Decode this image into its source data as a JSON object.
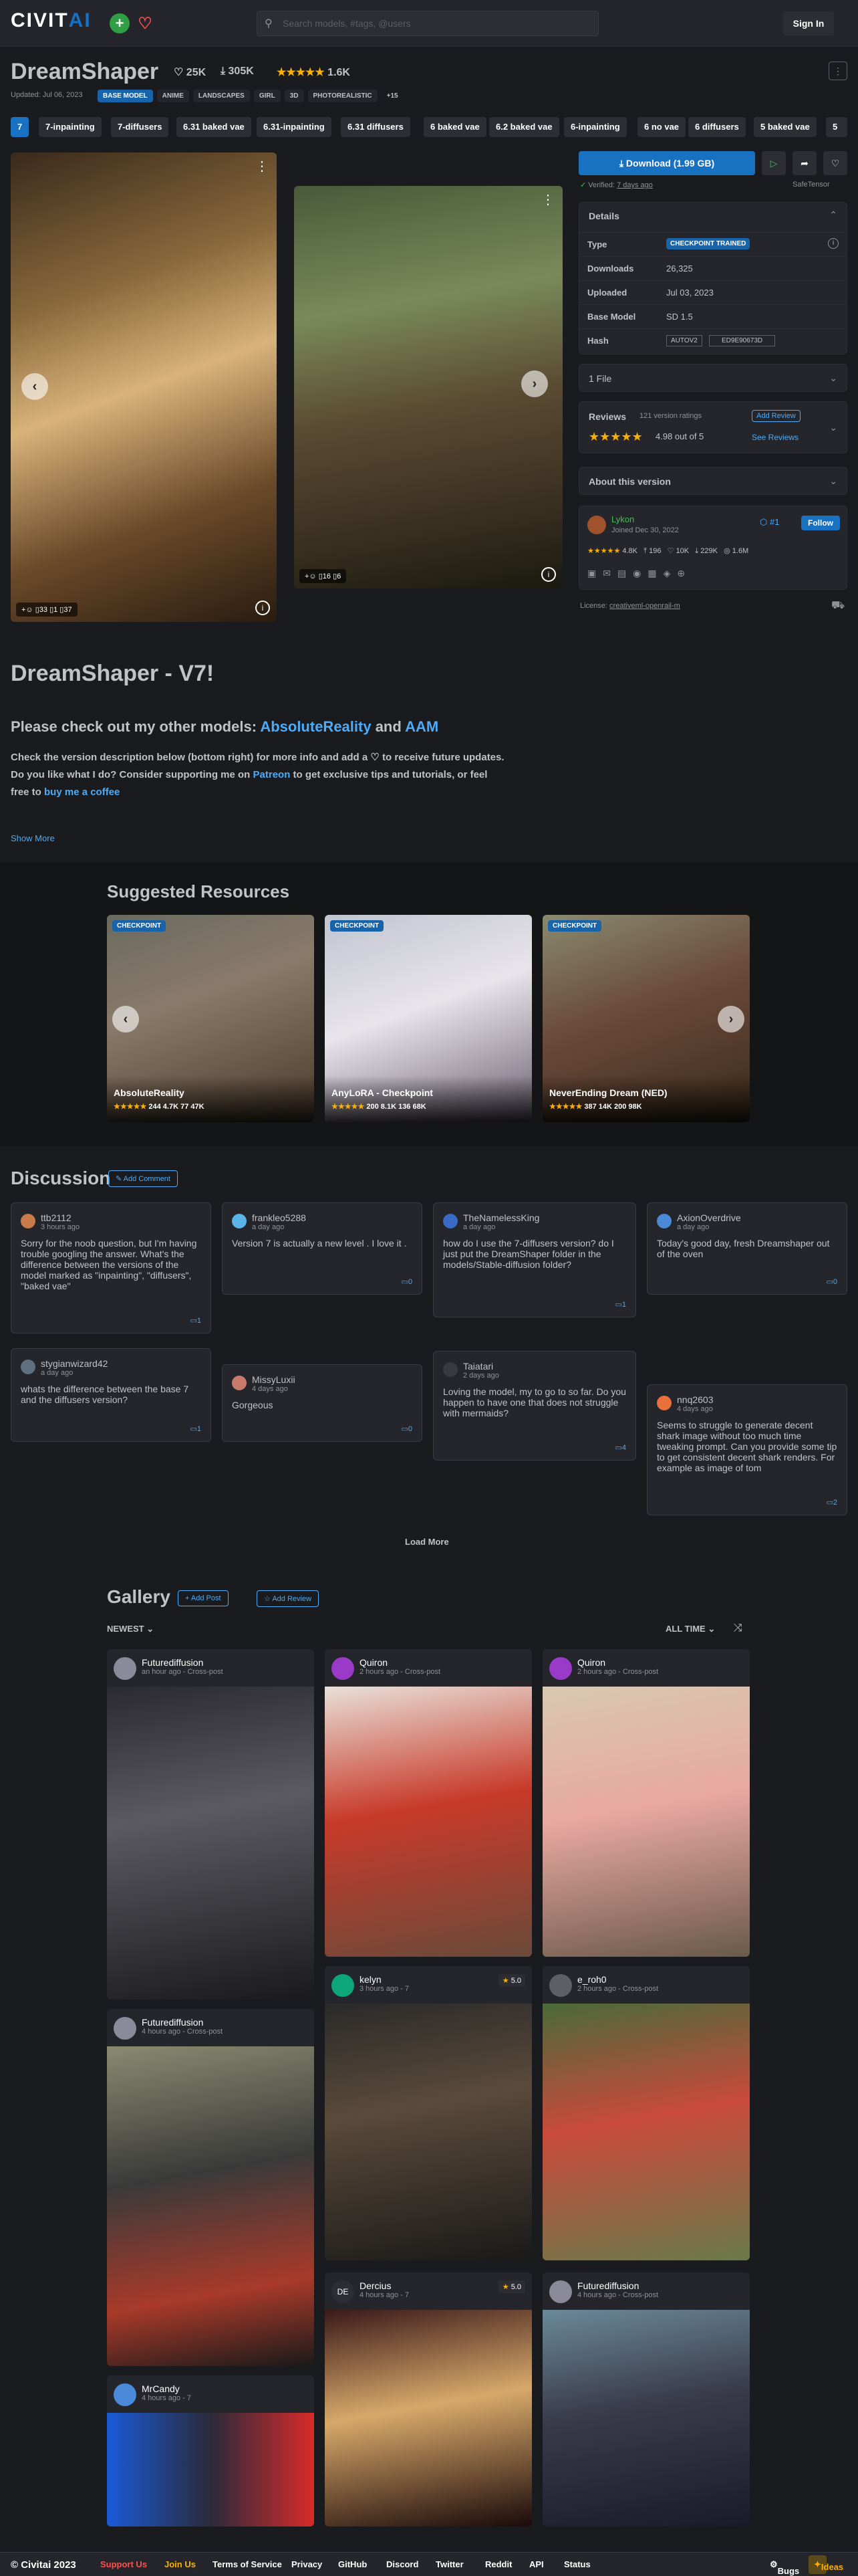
{
  "header": {
    "logo_a": "CIVIT",
    "logo_b": "AI",
    "search_placeholder": "Search models, #tags, @users",
    "signin": "Sign In"
  },
  "model": {
    "title": "DreamShaper",
    "likes": "25K",
    "downloads": "305K",
    "rating_count": "1.6K",
    "updated": "Updated: Jul 06, 2023",
    "badges": [
      "BASE MODEL",
      "ANIME",
      "LANDSCAPES",
      "GIRL",
      "3D",
      "PHOTOREALISTIC",
      "+15"
    ]
  },
  "version_tabs": [
    "7",
    "7-inpainting",
    "7-diffusers",
    "6.31 baked vae",
    "6.31-inpainting",
    "6.31 diffusers",
    "6 baked vae",
    "6.2 baked vae",
    "6-inpainting",
    "6 no vae",
    "6 diffusers",
    "5 baked vae",
    "5"
  ],
  "gallery_main": {
    "img1_stats": [
      "33",
      "1",
      "37"
    ],
    "img2_stats": [
      "16",
      "6"
    ]
  },
  "download": {
    "label": "Download (1.99 GB)",
    "verified": "Verified:",
    "verified_when": "7 days ago",
    "safetensor": "SafeTensor"
  },
  "details": {
    "title": "Details",
    "rows": [
      {
        "k": "Type",
        "v": "CHECKPOINT TRAINED"
      },
      {
        "k": "Downloads",
        "v": "26,325"
      },
      {
        "k": "Uploaded",
        "v": "Jul 03, 2023"
      },
      {
        "k": "Base Model",
        "v": "SD 1.5"
      },
      {
        "k": "Hash",
        "v": "AUTOV2",
        "v2": "ED9E90673D"
      }
    ]
  },
  "files": {
    "label": "1 File"
  },
  "reviews": {
    "label": "Reviews",
    "count": "121 version ratings",
    "add": "Add Review",
    "score": "4.98 out of 5",
    "see": "See Reviews"
  },
  "about": "About this version",
  "creator": {
    "name": "Lykon",
    "joined": "Joined Dec 30, 2022",
    "rank": "#1",
    "follow": "Follow",
    "stats": [
      "4.8K",
      "196",
      "10K",
      "229K",
      "1.6M"
    ]
  },
  "license": {
    "prefix": "License:",
    "link": "creativeml-openrail-m"
  },
  "description": {
    "heading": "DreamShaper - V7!",
    "line1a": "Please check out my other models: ",
    "link1": "AbsoluteReality",
    "and": " and ",
    "link2": "AAM",
    "p1": "Check the version description below (bottom right) for more info and add a ♡ to receive future updates.",
    "p2a": "Do you like what I do? Consider supporting me on ",
    "patreon": "Patreon",
    "p2b": " to get exclusive tips and tutorials, or feel",
    "p3a": "free to ",
    "coffee": "buy me a coffee",
    "show_more": "Show More"
  },
  "suggested": {
    "title": "Suggested Resources",
    "items": [
      {
        "tag": "CHECKPOINT",
        "name": "AbsoluteReality",
        "stats": "244   4.7K   77   47K"
      },
      {
        "tag": "CHECKPOINT",
        "name": "AnyLoRA - Checkpoint",
        "stats": "200   8.1K   136   68K"
      },
      {
        "tag": "CHECKPOINT",
        "name": "NeverEnding Dream (NED)",
        "stats": "387   14K   200   98K"
      }
    ]
  },
  "discussion": {
    "title": "Discussion",
    "add": "Add Comment",
    "load_more": "Load More",
    "comments": [
      {
        "user": "ttb2112",
        "time": "3 hours ago",
        "text": "Sorry for the noob question, but I'm having trouble googling the answer. What's the difference between the versions of the model marked as \"inpainting\", \"diffusers\", \"baked vae\"",
        "count": "1"
      },
      {
        "user": "frankleo5288",
        "time": "a day ago",
        "text": "Version 7 is actually a new level . I love it .",
        "count": "0"
      },
      {
        "user": "TheNamelessKing",
        "time": "a day ago",
        "text": "how do I use the 7-diffusers version? do I just put the DreamShaper folder in the models/Stable-diffusion folder?",
        "count": "1"
      },
      {
        "user": "AxionOverdrive",
        "time": "a day ago",
        "text": "Today's good day, fresh Dreamshaper out of the oven ",
        "count": "0"
      },
      {
        "user": "stygianwizard42",
        "time": "a day ago",
        "text": "whats the difference between the base 7 and the diffusers version?",
        "count": "1"
      },
      {
        "user": "MissyLuxii",
        "time": "4 days ago",
        "text": "Gorgeous",
        "count": "0"
      },
      {
        "user": "Taiatari",
        "time": "2 days ago",
        "text": "Loving the model, my to go to so far. Do you happen to have one that does not struggle with mermaids?",
        "count": "4"
      },
      {
        "user": "nnq2603",
        "time": "4 days ago",
        "text": "Seems to struggle to generate decent shark image without too much time tweaking prompt. Can you provide some tip to get consistent decent shark renders. For example as image of tom",
        "count": "2"
      }
    ]
  },
  "gallery": {
    "title": "Gallery",
    "add_post": "Add Post",
    "add_review": "Add Review",
    "sort": "NEWEST",
    "period": "ALL TIME",
    "posts": [
      {
        "user": "Futurediffusion",
        "time": "an hour ago - Cross-post"
      },
      {
        "user": "Quiron",
        "time": "2 hours ago - Cross-post"
      },
      {
        "user": "Quiron",
        "time": "2 hours ago - Cross-post"
      },
      {
        "user": "Futurediffusion",
        "time": "4 hours ago - Cross-post"
      },
      {
        "user": "kelyn",
        "time": "3 hours ago - 7",
        "score": "5.0"
      },
      {
        "user": "e_roh0",
        "time": "2 hours ago - Cross-post"
      },
      {
        "user": "Dercius",
        "time": "4 hours ago - 7",
        "score": "5.0"
      },
      {
        "user": "Futurediffusion",
        "time": "4 hours ago - Cross-post"
      },
      {
        "user": "MrCandy",
        "time": "4 hours ago - 7"
      }
    ]
  },
  "footer": {
    "copy": "© Civitai 2023",
    "links": [
      "Support Us",
      "Join Us",
      "Terms of Service",
      "Privacy",
      "GitHub",
      "Discord",
      "Twitter",
      "Reddit",
      "API",
      "Status"
    ],
    "bugs": "Bugs",
    "ideas": "Ideas"
  }
}
